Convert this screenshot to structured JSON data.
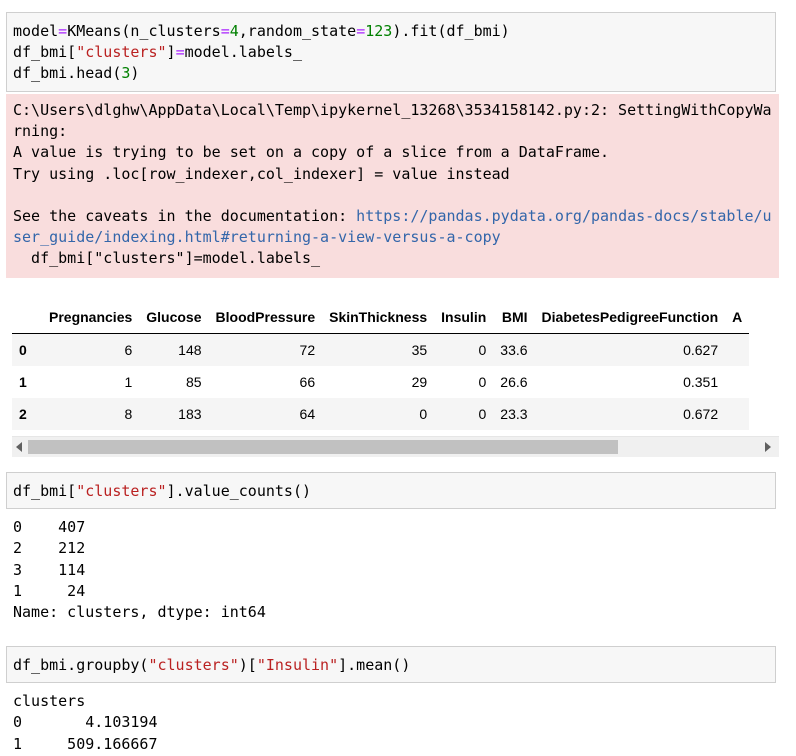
{
  "cell1": {
    "line1_prefix": "model",
    "line1_eq": "=",
    "line1_mid": "KMeans(n_clusters",
    "line1_eq2": "=",
    "line1_num1": "4",
    "line1_mid2": ",random_state",
    "line1_eq3": "=",
    "line1_num2": "123",
    "line1_suffix": ").fit(df_bmi)",
    "line2_prefix": "df_bmi[",
    "line2_str": "\"clusters\"",
    "line2_mid": "]",
    "line2_eq": "=",
    "line2_suffix": "model.labels_",
    "line3_prefix": "df_bmi.head(",
    "line3_num": "3",
    "line3_suffix": ")"
  },
  "warning": {
    "line1": "C:\\Users\\dlghw\\AppData\\Local\\Temp\\ipykernel_13268\\3534158142.py:2: SettingWithCopyWa",
    "line2": "rning:",
    "line3": "A value is trying to be set on a copy of a slice from a DataFrame.",
    "line4": "Try using .loc[row_indexer,col_indexer] = value instead",
    "line5": "",
    "line6_prefix": "See the caveats in the documentation: ",
    "link_part1": "https://pandas.pydata.org/pandas-docs/stable/u",
    "link_part2": "ser_guide/indexing.html#returning-a-view-versus-a-copy",
    "line8": "  df_bmi[\"clusters\"]=model.labels_"
  },
  "dataframe": {
    "columns": [
      "",
      "Pregnancies",
      "Glucose",
      "BloodPressure",
      "SkinThickness",
      "Insulin",
      "BMI",
      "DiabetesPedigreeFunction",
      "A"
    ],
    "rows": [
      {
        "index": "0",
        "values": [
          "6",
          "148",
          "72",
          "35",
          "0",
          "33.6",
          "0.627"
        ]
      },
      {
        "index": "1",
        "values": [
          "1",
          "85",
          "66",
          "29",
          "0",
          "26.6",
          "0.351"
        ]
      },
      {
        "index": "2",
        "values": [
          "8",
          "183",
          "64",
          "0",
          "0",
          "23.3",
          "0.672"
        ]
      }
    ]
  },
  "cell2": {
    "prefix": "df_bmi[",
    "str": "\"clusters\"",
    "suffix": "].value_counts()"
  },
  "output2": {
    "lines": [
      "0    407",
      "2    212",
      "3    114",
      "1     24",
      "Name: clusters, dtype: int64"
    ]
  },
  "cell3": {
    "prefix": "df_bmi.groupby(",
    "str1": "\"clusters\"",
    "mid": ")[",
    "str2": "\"Insulin\"",
    "suffix": "].mean()"
  },
  "output3": {
    "lines": [
      "clusters",
      "0       4.103194",
      "1     509.166667"
    ]
  }
}
